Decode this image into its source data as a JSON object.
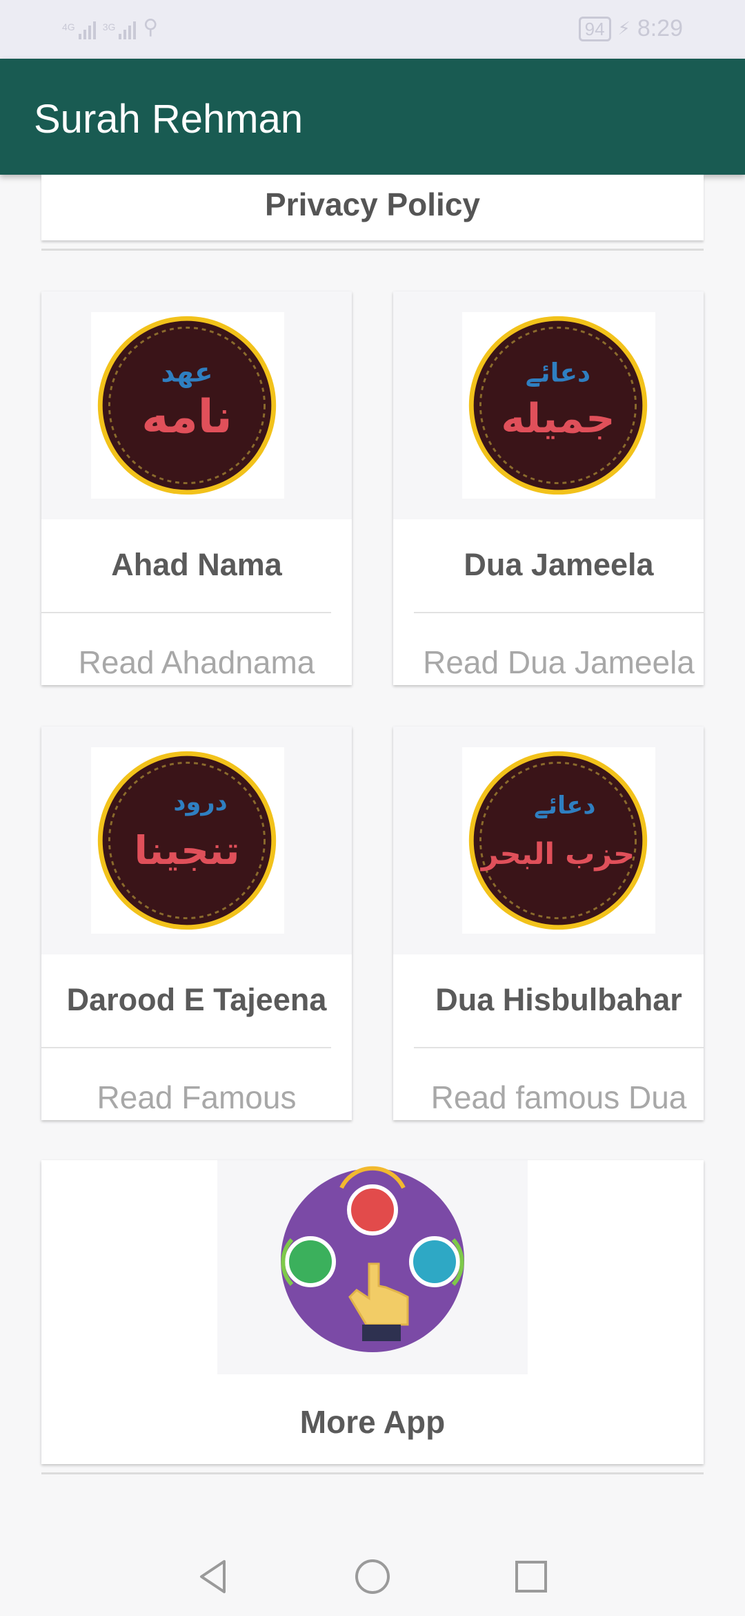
{
  "status_bar": {
    "net1": "4G",
    "net2": "3G",
    "battery": "94",
    "time": "8:29"
  },
  "app_bar": {
    "title": "Surah Rehman"
  },
  "privacy": {
    "label": "Privacy Policy"
  },
  "cards": [
    {
      "title": "Ahad Nama",
      "subtitle": "Read Ahadnama",
      "badge_top": "عهد",
      "badge_main": "نامه"
    },
    {
      "title": "Dua Jameela",
      "subtitle": "Read Dua Jameela",
      "badge_top": "دعائے",
      "badge_main": "جمیله"
    },
    {
      "title": "Darood E Tajeena",
      "subtitle": "Read Famous",
      "badge_top": "درود",
      "badge_main": "تنجینا"
    },
    {
      "title": "Dua Hisbulbahar",
      "subtitle": "Read famous Dua",
      "badge_top": "دعائے",
      "badge_main": "حزب البحر"
    }
  ],
  "more": {
    "title": "More App"
  },
  "colors": {
    "app_bar": "#195b52",
    "badge_ring": "#f2c21b",
    "badge_bg": "#3a1418",
    "badge_top_text": "#2f7fc1",
    "badge_main_text": "#e0505a"
  }
}
